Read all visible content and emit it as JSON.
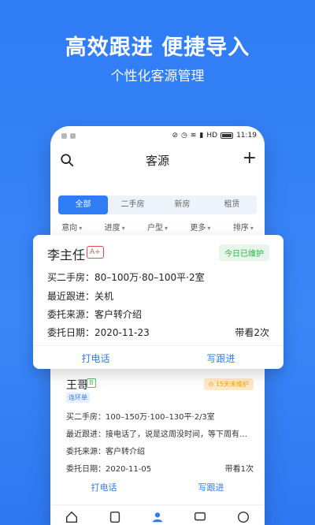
{
  "banner": {
    "headline": "高效跟进 便捷导入",
    "subheadline": "个性化客源管理"
  },
  "statusbar": {
    "icons": [
      "mute-icon",
      "alarm-icon",
      "wifi-icon",
      "signal-icon",
      "battery-icon"
    ],
    "network": "HD",
    "time": "11:19"
  },
  "nav": {
    "title": "客源",
    "search_icon": "search-icon",
    "add_icon": "plus-icon"
  },
  "tabs": [
    {
      "label": "全部",
      "active": true
    },
    {
      "label": "二手房"
    },
    {
      "label": "新房"
    },
    {
      "label": "租赁"
    }
  ],
  "filters": [
    "意向",
    "进度",
    "户型",
    "更多",
    "排序"
  ],
  "primary_card": {
    "name": "李主任",
    "grade": "A+",
    "status": "今日已维护",
    "line1": "买二手房：80–100万·80–100平·2室",
    "line2_label": "最近跟进：",
    "line2_value": "关机",
    "line3_label": "委托来源：",
    "line3_value": "客户转介绍",
    "line4_label": "委托日期：",
    "line4_value": "2020-11-23",
    "viewing": "带看2次",
    "actions": {
      "call": "打电话",
      "follow": "写跟进"
    }
  },
  "secondary_card": {
    "name": "王哥",
    "grade": "B",
    "tag": "连环单",
    "status": "15天未维护",
    "line1": "买二手房：100–150万·100–130平·2/3室",
    "line2": "最近跟进：接电话了，说是这周没时间，等下周有…",
    "line3": "委托来源：客户转介绍",
    "line4": "委托日期：2020-11-05",
    "viewing": "带看1次",
    "actions": {
      "call": "打电话",
      "follow": "写跟进"
    }
  },
  "tabbar": [
    "home-icon",
    "document-icon",
    "user-icon",
    "message-icon",
    "profile-icon"
  ],
  "colors": {
    "brand": "#2f7cf6",
    "success": "#33b04a",
    "warning": "#f4a000",
    "grade_a": "#e64c4c"
  }
}
